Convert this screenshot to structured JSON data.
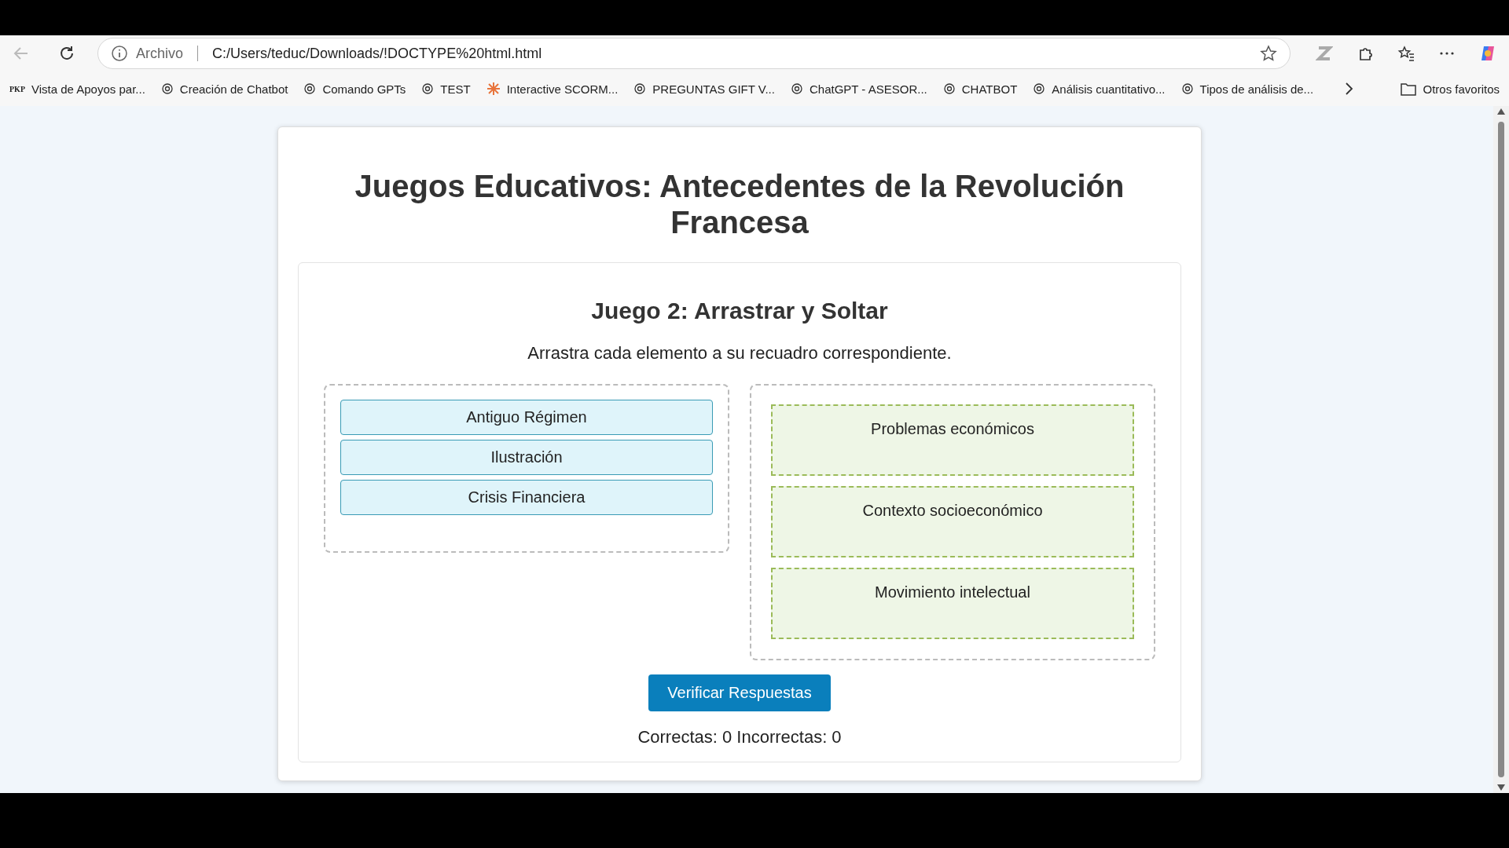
{
  "browser": {
    "address_label": "Archivo",
    "url": "C:/Users/teduc/Downloads/!DOCTYPE%20html.html",
    "bookmarks": [
      {
        "label": "Vista de Apoyos par...",
        "kind": "pkp",
        "logo_text": "PKP"
      },
      {
        "label": "Creación de Chatbot",
        "kind": "openai"
      },
      {
        "label": "Comando GPTs",
        "kind": "openai"
      },
      {
        "label": "TEST",
        "kind": "openai"
      },
      {
        "label": "Interactive SCORM...",
        "kind": "asterisk"
      },
      {
        "label": "PREGUNTAS GIFT V...",
        "kind": "openai"
      },
      {
        "label": "ChatGPT - ASESOR...",
        "kind": "openai"
      },
      {
        "label": "CHATBOT",
        "kind": "openai"
      },
      {
        "label": "Análisis cuantitativo...",
        "kind": "openai"
      },
      {
        "label": "Tipos de análisis de...",
        "kind": "openai"
      }
    ],
    "other_favorites": "Otros favoritos"
  },
  "page": {
    "title": "Juegos Educativos: Antecedentes de la Revolución Francesa",
    "game": {
      "title": "Juego 2: Arrastrar y Soltar",
      "instruction": "Arrastra cada elemento a su recuadro correspondiente.",
      "items": [
        "Antiguo Régimen",
        "Ilustración",
        "Crisis Financiera"
      ],
      "targets": [
        "Problemas económicos",
        "Contexto socioeconómico",
        "Movimiento intelectual"
      ],
      "button": "Verificar Respuestas",
      "score": "Correctas: 0 Incorrectas: 0"
    }
  }
}
